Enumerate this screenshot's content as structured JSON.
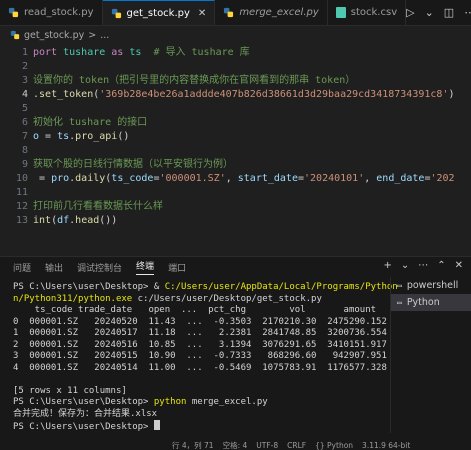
{
  "tabs": [
    {
      "label": "read_stock.py",
      "italic": false,
      "active": false
    },
    {
      "label": "get_stock.py",
      "italic": false,
      "active": true
    },
    {
      "label": "merge_excel.py",
      "italic": true,
      "active": false
    },
    {
      "label": "stock.csv",
      "italic": false,
      "active": false
    }
  ],
  "breadcrumb": {
    "file": "get_stock.py",
    "separator": ">",
    "trail": "..."
  },
  "editor": {
    "current_line": 4,
    "lines": [
      {
        "n": "1",
        "parts": [
          [
            "kw",
            "port "
          ],
          [
            "mod",
            "tushare"
          ],
          [
            "kw",
            " as "
          ],
          [
            "mod",
            "ts"
          ],
          [
            "cm",
            "  # 导入 tushare 库"
          ]
        ]
      },
      {
        "n": "2",
        "parts": []
      },
      {
        "n": "3",
        "parts": [
          [
            "cm",
            "设置你的 token（把引号里的内容替换成你在官网看到的那串 token）"
          ]
        ]
      },
      {
        "n": "4",
        "parts": [
          [
            "plain",
            "."
          ],
          [
            "fn",
            "set_token"
          ],
          [
            "plain",
            "("
          ],
          [
            "str",
            "'369b28e4be26a1addde407b826d38661d3d29baa29cd3418734391c8'"
          ],
          [
            "plain",
            ")"
          ]
        ]
      },
      {
        "n": "5",
        "parts": []
      },
      {
        "n": "6",
        "parts": [
          [
            "cm",
            "初始化 tushare 的接口"
          ]
        ]
      },
      {
        "n": "7",
        "parts": [
          [
            "var",
            "o"
          ],
          [
            "plain",
            " = "
          ],
          [
            "var",
            "ts"
          ],
          [
            "plain",
            "."
          ],
          [
            "fn",
            "pro_api"
          ],
          [
            "plain",
            "()"
          ]
        ]
      },
      {
        "n": "8",
        "parts": []
      },
      {
        "n": "9",
        "parts": [
          [
            "cm",
            "获取个股的日线行情数据（以平安银行为例）"
          ]
        ]
      },
      {
        "n": "10",
        "parts": [
          [
            "plain",
            " = "
          ],
          [
            "var",
            "pro"
          ],
          [
            "plain",
            "."
          ],
          [
            "fn",
            "daily"
          ],
          [
            "plain",
            "("
          ],
          [
            "var",
            "ts_code"
          ],
          [
            "plain",
            "="
          ],
          [
            "str",
            "'000001.SZ'"
          ],
          [
            "plain",
            ", "
          ],
          [
            "var",
            "start_date"
          ],
          [
            "plain",
            "="
          ],
          [
            "str",
            "'20240101'"
          ],
          [
            "plain",
            ", "
          ],
          [
            "var",
            "end_date"
          ],
          [
            "plain",
            "="
          ],
          [
            "str",
            "'202"
          ]
        ]
      },
      {
        "n": "11",
        "parts": []
      },
      {
        "n": "12",
        "parts": [
          [
            "cm",
            "打印前几行看看数据长什么样"
          ]
        ]
      },
      {
        "n": "13",
        "parts": [
          [
            "fn",
            "int"
          ],
          [
            "plain",
            "("
          ],
          [
            "var",
            "df"
          ],
          [
            "plain",
            "."
          ],
          [
            "fn",
            "head"
          ],
          [
            "plain",
            "())"
          ]
        ]
      }
    ]
  },
  "panel": {
    "tabs": [
      "问题",
      "输出",
      "调试控制台",
      "终端",
      "端口"
    ],
    "active_tab": "终端",
    "terminal_lines": [
      [
        [
          "plain",
          "PS C:\\Users\\user\\Desktop> & "
        ],
        [
          "yel",
          "C:/Users/user/AppData/Local/Programs/Python"
        ]
      ],
      [
        [
          "yel",
          "n/Python311/python.exe"
        ],
        [
          "plain",
          " c:/Users/user/Desktop/get_stock.py"
        ]
      ],
      [
        [
          "plain",
          "    ts_code trade_date   open  ...  pct_chg        vol       amount"
        ]
      ],
      [
        [
          "plain",
          "0  000001.SZ   20240520  11.43  ...  -0.3503  2170210.30  2475290.152"
        ]
      ],
      [
        [
          "plain",
          "1  000001.SZ   20240517  11.18  ...   2.2381  2841748.85  3200736.554"
        ]
      ],
      [
        [
          "plain",
          "2  000001.SZ   20240516  10.85  ...   3.1394  3076291.65  3410151.917"
        ]
      ],
      [
        [
          "plain",
          "3  000001.SZ   20240515  10.90  ...  -0.7333   868296.60   942907.951"
        ]
      ],
      [
        [
          "plain",
          "4  000001.SZ   20240514  11.00  ...  -0.5469  1075783.91  1176577.328"
        ]
      ],
      [
        [
          "plain",
          ""
        ]
      ],
      [
        [
          "plain",
          "[5 rows x 11 columns]"
        ]
      ],
      [
        [
          "plain",
          "PS C:\\Users\\user\\Desktop> "
        ],
        [
          "yel",
          "python"
        ],
        [
          "plain",
          " merge_excel.py"
        ]
      ],
      [
        [
          "plain",
          "合并完成！保存为：合并结果.xlsx"
        ]
      ],
      [
        [
          "plain",
          "PS C:\\Users\\user\\Desktop> "
        ]
      ]
    ],
    "terminals": [
      {
        "label": "powershell",
        "active": false
      },
      {
        "label": "Python",
        "active": true
      }
    ]
  },
  "statusbar": {
    "items": [
      "行 4，列 71",
      "空格: 4",
      "UTF-8",
      "CRLF",
      "{} Python",
      "3.11.9 64-bit"
    ]
  },
  "colors": {
    "accent": "#0078d4",
    "background": "#1f1f1f",
    "panel": "#181818",
    "python_blue": "#3572a5",
    "python_yellow": "#ffd43b"
  },
  "icons": {
    "run": "play-icon",
    "split": "split-editor-icon",
    "more": "ellipsis-icon"
  }
}
